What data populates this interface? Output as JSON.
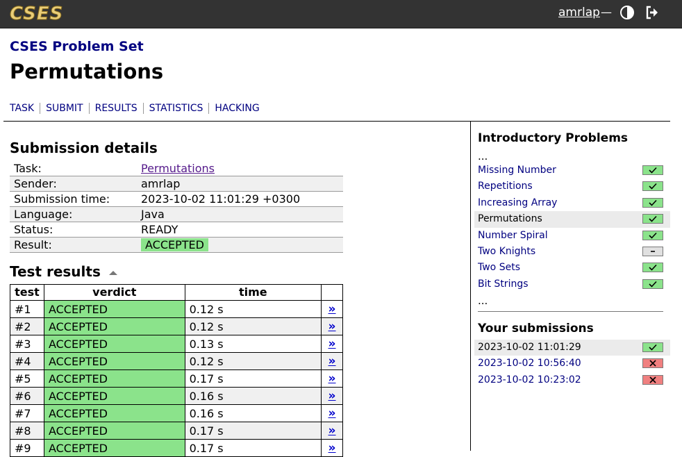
{
  "header": {
    "logo": "CSES",
    "username": "amrlap",
    "dash": "—",
    "theme_icon": "contrast-icon",
    "logout_icon": "logout-icon"
  },
  "site_title": "CSES Problem Set",
  "page_title": "Permutations",
  "nav": [
    "TASK",
    "SUBMIT",
    "RESULTS",
    "STATISTICS",
    "HACKING"
  ],
  "details": {
    "heading": "Submission details",
    "rows": [
      {
        "label": "Task:",
        "value": "Permutations"
      },
      {
        "label": "Sender:",
        "value": "amrlap"
      },
      {
        "label": "Submission time:",
        "value": "2023-10-02 11:01:29 +0300"
      },
      {
        "label": "Language:",
        "value": "Java"
      },
      {
        "label": "Status:",
        "value": "READY"
      },
      {
        "label": "Result:",
        "value": "ACCEPTED"
      }
    ]
  },
  "tests": {
    "heading": "Test results",
    "headers": [
      "test",
      "verdict",
      "time",
      ""
    ],
    "link_label": "»",
    "rows": [
      {
        "test": "#1",
        "verdict": "ACCEPTED",
        "time": "0.12 s"
      },
      {
        "test": "#2",
        "verdict": "ACCEPTED",
        "time": "0.12 s"
      },
      {
        "test": "#3",
        "verdict": "ACCEPTED",
        "time": "0.13 s"
      },
      {
        "test": "#4",
        "verdict": "ACCEPTED",
        "time": "0.12 s"
      },
      {
        "test": "#5",
        "verdict": "ACCEPTED",
        "time": "0.17 s"
      },
      {
        "test": "#6",
        "verdict": "ACCEPTED",
        "time": "0.16 s"
      },
      {
        "test": "#7",
        "verdict": "ACCEPTED",
        "time": "0.16 s"
      },
      {
        "test": "#8",
        "verdict": "ACCEPTED",
        "time": "0.17 s"
      },
      {
        "test": "#9",
        "verdict": "ACCEPTED",
        "time": "0.17 s"
      }
    ]
  },
  "sidebar": {
    "category": "Introductory Problems",
    "ellipsis": "...",
    "problems": [
      {
        "name": "Missing Number",
        "status": "ok",
        "current": false
      },
      {
        "name": "Repetitions",
        "status": "ok",
        "current": false
      },
      {
        "name": "Increasing Array",
        "status": "ok",
        "current": false
      },
      {
        "name": "Permutations",
        "status": "ok",
        "current": true
      },
      {
        "name": "Number Spiral",
        "status": "ok",
        "current": false
      },
      {
        "name": "Two Knights",
        "status": "none",
        "current": false
      },
      {
        "name": "Two Sets",
        "status": "ok",
        "current": false
      },
      {
        "name": "Bit Strings",
        "status": "ok",
        "current": false
      }
    ],
    "submissions_heading": "Your submissions",
    "submissions": [
      {
        "time": "2023-10-02 11:01:29",
        "status": "ok",
        "current": true
      },
      {
        "time": "2023-10-02 10:56:40",
        "status": "fail",
        "current": false
      },
      {
        "time": "2023-10-02 10:23:02",
        "status": "fail",
        "current": false
      }
    ]
  },
  "colors": {
    "accepted": "#8be38b",
    "failed": "#f08080",
    "link": "#000080",
    "topbar": "#333333",
    "logo": "#e9cd78"
  }
}
